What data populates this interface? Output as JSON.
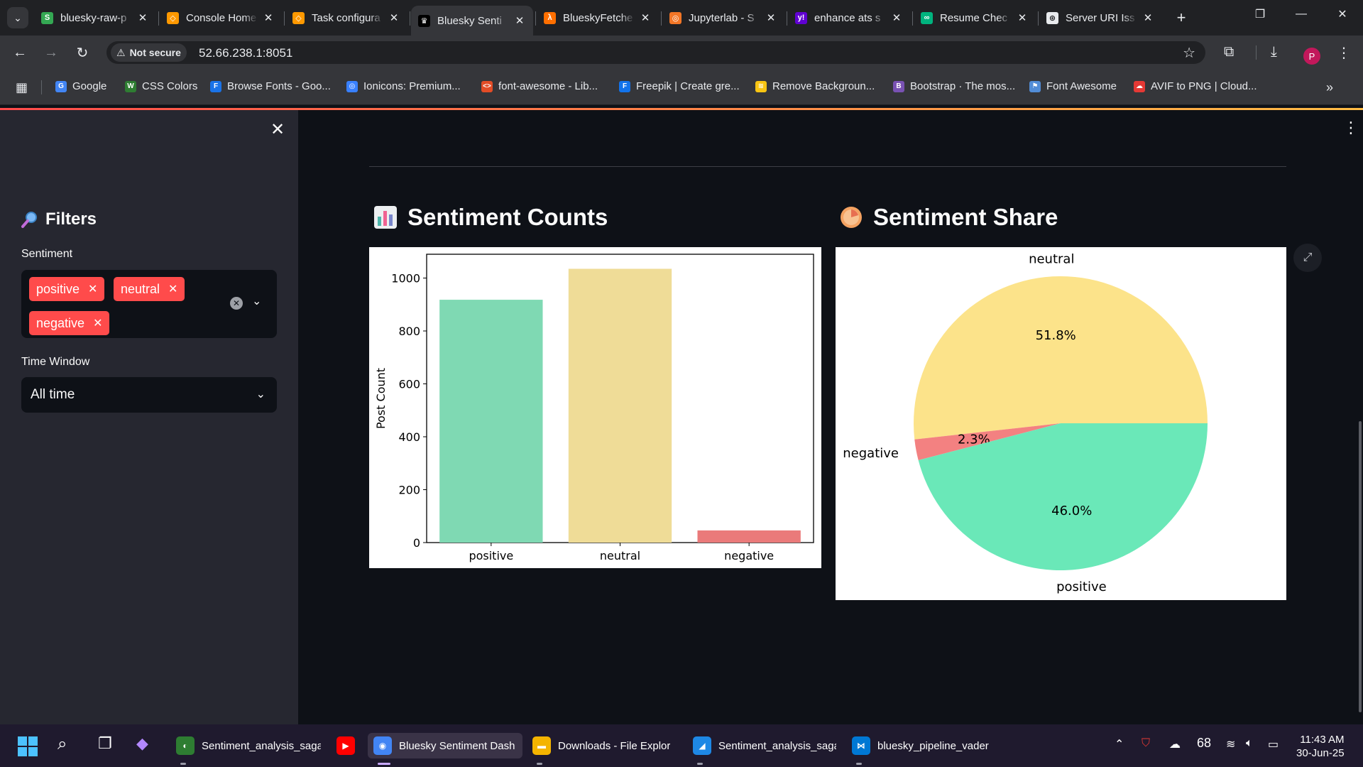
{
  "browser": {
    "tabs": [
      {
        "label": "bluesky-raw-p",
        "color": "#34a853",
        "glyph": "S"
      },
      {
        "label": "Console Home",
        "color": "#ff9900",
        "glyph": "◇"
      },
      {
        "label": "Task configura",
        "color": "#ff9900",
        "glyph": "◇"
      },
      {
        "label": "Bluesky Senti",
        "color": "#000000",
        "glyph": "♛",
        "active": true
      },
      {
        "label": "BlueskyFetche",
        "color": "#ff6f00",
        "glyph": "λ"
      },
      {
        "label": "Jupyterlab - S",
        "color": "#f37626",
        "glyph": "◎"
      },
      {
        "label": "enhance ats s",
        "color": "#6001d2",
        "glyph": "y!"
      },
      {
        "label": "Resume Chec",
        "color": "#00b37e",
        "glyph": "∞"
      },
      {
        "label": "Server URI Iss",
        "color": "#e8eaed",
        "glyph": "⊛"
      }
    ],
    "security_label": "Not secure",
    "url": "52.66.238.1:8051",
    "profile_initial": "P",
    "bookmarks": [
      {
        "label": "Google",
        "color": "#4285f4",
        "glyph": "G"
      },
      {
        "label": "CSS Colors",
        "color": "#2e7d32",
        "glyph": "W"
      },
      {
        "label": "Browse Fonts - Goo...",
        "color": "#1a73e8",
        "glyph": "F"
      },
      {
        "label": "Ionicons: Premium...",
        "color": "#3880ff",
        "glyph": "◎"
      },
      {
        "label": "font-awesome - Lib...",
        "color": "#e34c26",
        "glyph": "<>"
      },
      {
        "label": "Freepik | Create gre...",
        "color": "#1273eb",
        "glyph": "F"
      },
      {
        "label": "Remove Backgroun...",
        "color": "#f9c513",
        "glyph": "≋"
      },
      {
        "label": "Bootstrap · The mos...",
        "color": "#7952b3",
        "glyph": "B"
      },
      {
        "label": "Font Awesome",
        "color": "#528dd7",
        "glyph": "⚑"
      },
      {
        "label": "AVIF to PNG | Cloud...",
        "color": "#e53935",
        "glyph": "☁"
      }
    ]
  },
  "sidebar": {
    "title": "Filters",
    "sentiment_label": "Sentiment",
    "sentiment_selected": [
      "positive",
      "neutral",
      "negative"
    ],
    "time_window_label": "Time Window",
    "time_window_value": "All time"
  },
  "main": {
    "counts_title": "Sentiment Counts",
    "share_title": "Sentiment Share"
  },
  "chart_data": [
    {
      "type": "bar",
      "title": "",
      "xlabel": "",
      "ylabel": "Post Count",
      "categories": [
        "positive",
        "neutral",
        "negative"
      ],
      "values": [
        918,
        1035,
        46
      ],
      "colors": [
        "#7fd9b3",
        "#efdc97",
        "#ea7a7a"
      ],
      "ylim": [
        0,
        1090
      ],
      "yticks": [
        0,
        200,
        400,
        600,
        800,
        1000
      ],
      "grid": false
    },
    {
      "type": "pie",
      "title": "",
      "labels": [
        "neutral",
        "negative",
        "positive"
      ],
      "values": [
        51.8,
        2.3,
        46.0
      ],
      "pct_labels": [
        "51.8%",
        "2.3%",
        "46.0%"
      ],
      "colors": [
        "#fce38a",
        "#f38181",
        "#6ae8b8"
      ]
    }
  ],
  "taskbar": {
    "apps": [
      {
        "label": "Sentiment_analysis_saga",
        "color": "#2e7d32",
        "glyph": "◐"
      },
      {
        "label": "",
        "color": "#ff0000",
        "glyph": "▶"
      },
      {
        "label": "Bluesky Sentiment Dash",
        "color": "#4285f4",
        "glyph": "◉",
        "active": true
      },
      {
        "label": "Downloads - File Explor",
        "color": "#f4b400",
        "glyph": "▬"
      },
      {
        "label": "Sentiment_analysis_saga",
        "color": "#1e88e5",
        "glyph": "◢"
      },
      {
        "label": "bluesky_pipeline_vader",
        "color": "#0078d4",
        "glyph": "⋈"
      }
    ],
    "battery_text": "68",
    "time": "11:43 AM",
    "date": "30-Jun-25"
  }
}
